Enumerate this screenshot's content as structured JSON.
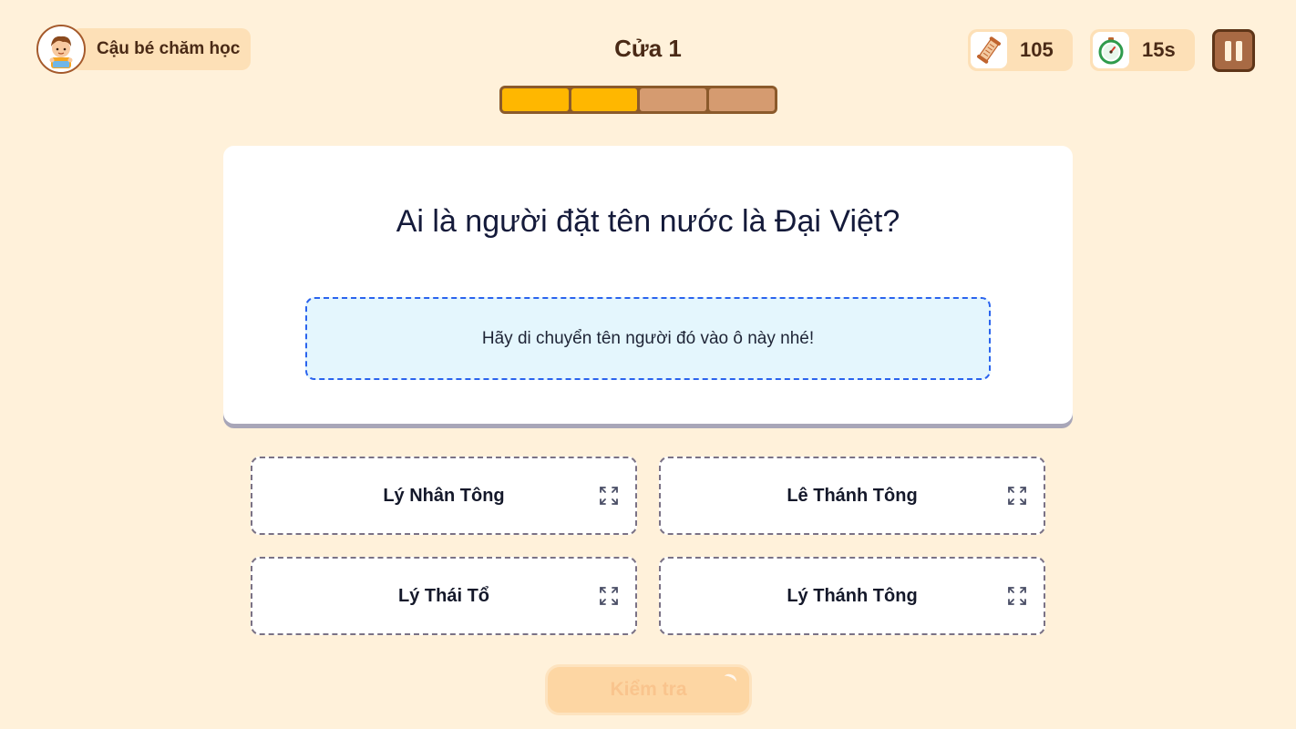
{
  "player": {
    "name": "Cậu bé chăm học",
    "avatar_icon": "boy-avatar-icon"
  },
  "level": {
    "title": "Cửa 1",
    "progress_total": 4,
    "progress_done": 2
  },
  "stats": {
    "scrolls_icon": "scroll-icon",
    "scrolls": "105",
    "timer_icon": "stopwatch-icon",
    "timer": "15s"
  },
  "pause_icon": "pause-icon",
  "question": {
    "text": "Ai là người đặt tên nước là Đại Việt?",
    "drop_hint": "Hãy di chuyển tên người đó vào ô này nhé!"
  },
  "options": [
    {
      "label": "Lý Nhân Tông"
    },
    {
      "label": "Lê Thánh Tông"
    },
    {
      "label": "Lý Thái Tổ"
    },
    {
      "label": "Lý Thánh Tông"
    }
  ],
  "check_button": {
    "label": "Kiểm tra",
    "enabled": false
  },
  "colors": {
    "background": "#fff1da",
    "pill": "#fde0b7",
    "progress_filled": "#ffb700",
    "progress_empty": "#d59b70",
    "progress_border": "#8b5a2b",
    "drop_zone_border": "#2a63ee",
    "drop_zone_fill": "#e4f6fd",
    "pause_button": "#a86a44",
    "check_button_disabled": "#fdd6a3"
  }
}
